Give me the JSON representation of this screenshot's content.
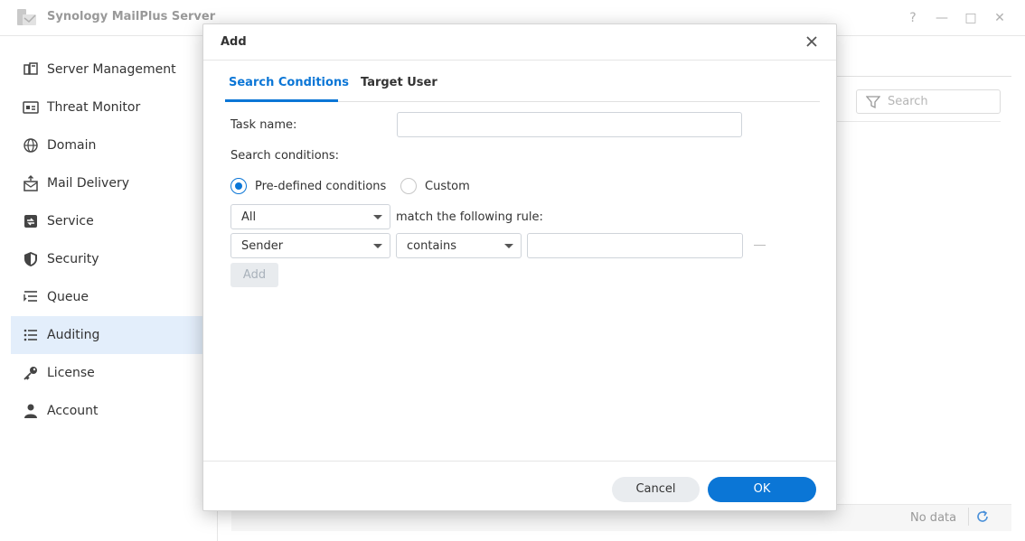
{
  "app": {
    "title": "Synology MailPlus Server",
    "window_buttons": [
      "?",
      "—",
      "□",
      "✕"
    ]
  },
  "sidebar": {
    "items": [
      {
        "label": "Server Management",
        "icon": "server-icon",
        "active": false
      },
      {
        "label": "Threat Monitor",
        "icon": "monitor-icon",
        "active": false
      },
      {
        "label": "Domain",
        "icon": "globe-icon",
        "active": false
      },
      {
        "label": "Mail Delivery",
        "icon": "mail-upload-icon",
        "active": false
      },
      {
        "label": "Service",
        "icon": "service-icon",
        "active": false
      },
      {
        "label": "Security",
        "icon": "shield-icon",
        "active": false
      },
      {
        "label": "Queue",
        "icon": "queue-icon",
        "active": false
      },
      {
        "label": "Auditing",
        "icon": "list-icon",
        "active": true
      },
      {
        "label": "License",
        "icon": "key-icon",
        "active": false
      },
      {
        "label": "Account",
        "icon": "person-icon",
        "active": false
      }
    ]
  },
  "background": {
    "search_placeholder": "Search",
    "no_data": "No data"
  },
  "dialog": {
    "title": "Add",
    "tabs": [
      {
        "label": "Search Conditions",
        "active": true
      },
      {
        "label": "Target User",
        "active": false
      }
    ],
    "task_name_label": "Task name:",
    "task_name_value": "",
    "search_conditions_label": "Search conditions:",
    "radio_predefined": "Pre-defined conditions",
    "radio_custom": "Custom",
    "selected_radio": "predefined",
    "match_select": "All",
    "match_text": "match the following rule:",
    "rule": {
      "field": "Sender",
      "operator": "contains",
      "value": ""
    },
    "add_button": "Add",
    "cancel_button": "Cancel",
    "ok_button": "OK"
  },
  "colors": {
    "accent": "#0b76d6",
    "sidebar_active": "#e3eefb"
  }
}
